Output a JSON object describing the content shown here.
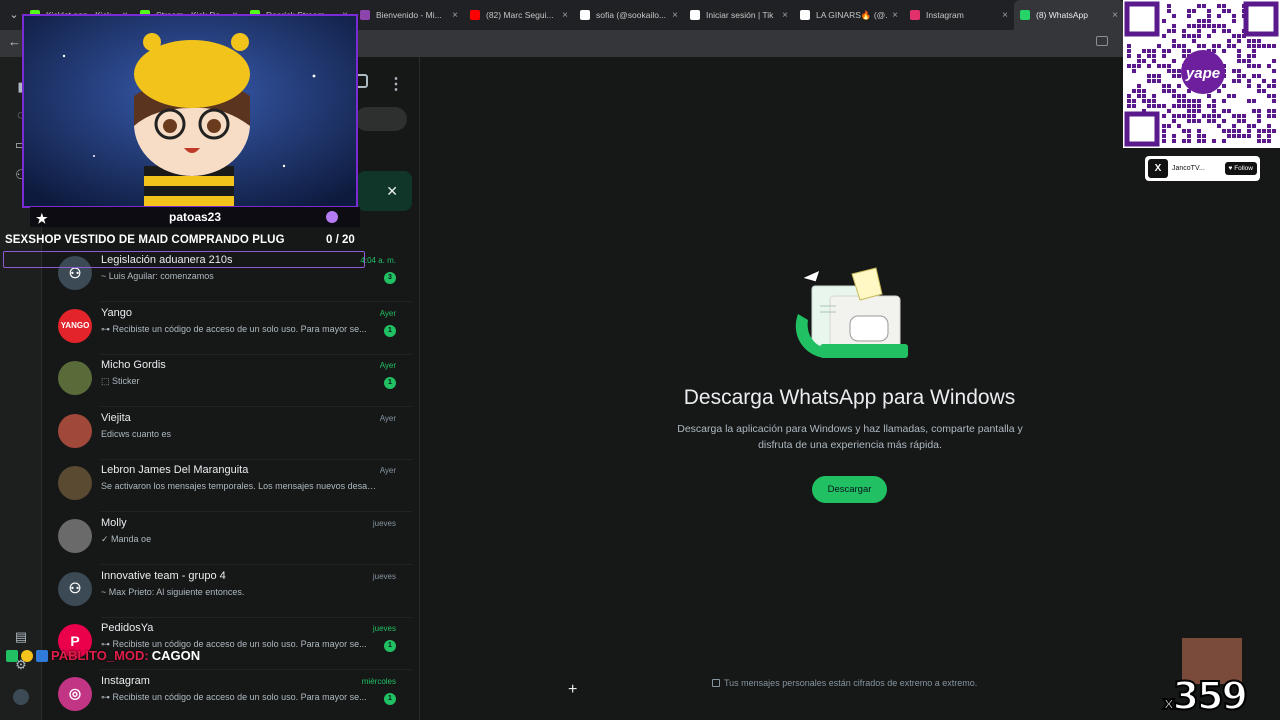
{
  "browser": {
    "tabs": [
      {
        "title": "Kicklet.app - Kick",
        "color": "#53fc18",
        "active": false
      },
      {
        "title": "Stream - Kick Da...",
        "color": "#53fc18",
        "active": false
      },
      {
        "title": "Dearick Stream",
        "color": "#53fc18",
        "active": false
      },
      {
        "title": "Bienvenido - Mi...",
        "color": "#8e44ad",
        "active": false
      },
      {
        "title": "(82) Marc Segui...",
        "color": "#ff0000",
        "active": false
      },
      {
        "title": "sofia (@sookailo...",
        "color": "#ffffff",
        "active": false
      },
      {
        "title": "Iniciar sesión | Tik",
        "color": "#ffffff",
        "active": false
      },
      {
        "title": "LA GINARS🔥 (@...",
        "color": "#ffffff",
        "active": false
      },
      {
        "title": "Instagram",
        "color": "#e1306c",
        "active": false
      },
      {
        "title": "(8) WhatsApp",
        "color": "#25d366",
        "active": true
      }
    ],
    "close_glyph": "×",
    "menu_glyph": "⌄",
    "back_glyph": "←"
  },
  "chats": [
    {
      "name": "Legislación aduanera 210s",
      "preview": "~ Luis Aguilar: comenzamos",
      "time": "4:04 a. m.",
      "time_green": true,
      "unread": "3",
      "avatar_type": "group",
      "avatar_color": "#3b4a54"
    },
    {
      "name": "Yango",
      "preview": "⊶ Recibiste un código de acceso de un solo uso. Para mayor se...",
      "time": "Ayer",
      "time_green": true,
      "unread": "1",
      "avatar_type": "logo",
      "avatar_text": "YANGO",
      "avatar_color": "#e3242b"
    },
    {
      "name": "Micho Gordis",
      "preview": "⬚ Sticker",
      "time": "Ayer",
      "time_green": true,
      "unread": "1",
      "avatar_type": "photo",
      "avatar_color": "#5a6b3a"
    },
    {
      "name": "Viejita",
      "preview": "Edicws cuanto es",
      "time": "Ayer",
      "time_green": false,
      "unread": "",
      "avatar_type": "photo",
      "avatar_color": "#a0483a"
    },
    {
      "name": "Lebron James Del Maranguita",
      "preview": "Se activaron los mensajes temporales. Los mensajes nuevos desapa...",
      "time": "Ayer",
      "time_green": false,
      "unread": "",
      "avatar_type": "photo",
      "avatar_color": "#5b4a32"
    },
    {
      "name": "Molly",
      "preview": "✓ Manda oe",
      "time": "jueves",
      "time_green": false,
      "unread": "",
      "avatar_type": "photo",
      "avatar_color": "#6b6a6a"
    },
    {
      "name": "Innovative team - grupo 4",
      "preview": "~ Max Prieto: Al siguiente entonces.",
      "time": "jueves",
      "time_green": false,
      "unread": "",
      "avatar_type": "group",
      "avatar_color": "#3b4a54"
    },
    {
      "name": "PedidosYa",
      "preview": "⊶ Recibiste un código de acceso de un solo uso. Para mayor se...",
      "time": "jueves",
      "time_green": true,
      "unread": "1",
      "avatar_type": "logo",
      "avatar_text": "P",
      "avatar_color": "#ea004b"
    },
    {
      "name": "Instagram",
      "preview": "⊶ Recibiste un código de acceso de un solo uso. Para mayor se...",
      "time": "miércoles",
      "time_green": true,
      "unread": "1",
      "avatar_type": "logo",
      "avatar_text": "◎",
      "avatar_color": "#c13584"
    }
  ],
  "main": {
    "title": "Descarga WhatsApp para Windows",
    "subtitle": "Descarga la aplicación para Windows y haz llamadas, comparte pantalla y disfruta de una experiencia más rápida.",
    "download_label": "Descargar",
    "e2e_text": "Tus mensajes personales están cifrados de extremo a extremo."
  },
  "banner": {
    "close_glyph": "✕"
  },
  "overlay": {
    "streamer_name": "patoas23",
    "goal_text": "SEXSHOP VESTIDO DE MAID COMPRANDO PLUG",
    "goal_count": "0  / 20",
    "star_glyph": "★",
    "qr_label": "yape",
    "twitter_handle": "JancoTV...",
    "twitter_icon": "X",
    "follow_label": "♥ Follow",
    "counter_prefix": "x",
    "counter_value": "359",
    "mod_name": "PABLITO_MOD:",
    "mod_message": "CAGON"
  },
  "colors": {
    "accent": "#21c063",
    "stream_purple": "#7a2bd3"
  }
}
